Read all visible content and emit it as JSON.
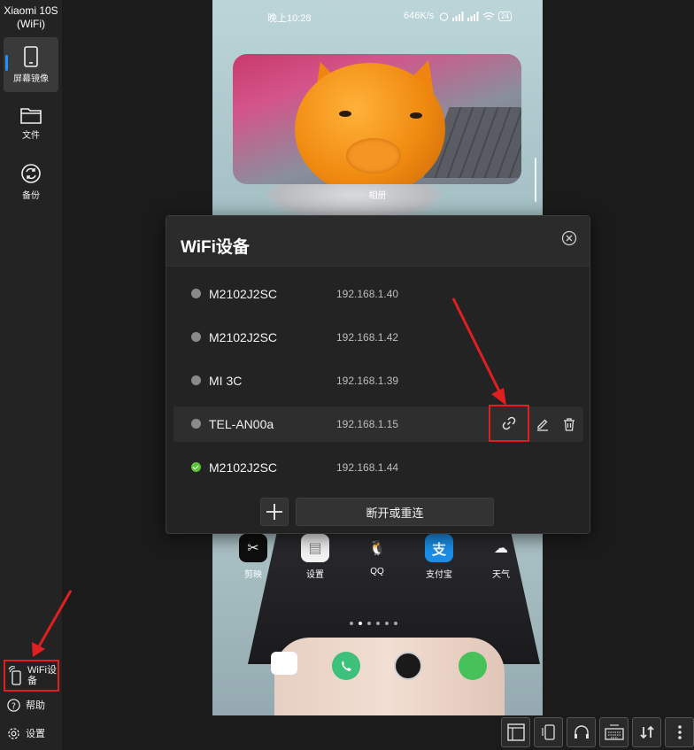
{
  "sidebar": {
    "device_title": "Xiaomi 10S (WiFi)",
    "nav": [
      {
        "label": "屏幕镜像",
        "icon": "phone-icon",
        "active": true
      },
      {
        "label": "文件",
        "icon": "folder-icon",
        "active": false
      },
      {
        "label": "备份",
        "icon": "sync-icon",
        "active": false
      }
    ],
    "wifi_devices_label": "WiFi设备",
    "help_label": "帮助",
    "settings_label": "设置"
  },
  "phone": {
    "status_time": "晚上10:28",
    "status_net": "646K/s",
    "status_battery": "24",
    "widget_label": "相册",
    "apps": [
      {
        "label": "剪映",
        "icon": "jianying-icon",
        "glyph": "✂"
      },
      {
        "label": "设置",
        "icon": "settings-app-icon",
        "glyph": "▤"
      },
      {
        "label": "QQ",
        "icon": "qq-icon",
        "glyph": "🐧"
      },
      {
        "label": "支付宝",
        "icon": "alipay-icon",
        "glyph": "支"
      },
      {
        "label": "天气",
        "icon": "weather-icon",
        "glyph": "☁"
      }
    ]
  },
  "dialog": {
    "title": "WiFi设备",
    "devices": [
      {
        "name": "M2102J2SC",
        "ip": "192.168.1.40",
        "status": "offline"
      },
      {
        "name": "M2102J2SC",
        "ip": "192.168.1.42",
        "status": "offline"
      },
      {
        "name": "MI 3C",
        "ip": "192.168.1.39",
        "status": "offline"
      },
      {
        "name": "TEL-AN00a",
        "ip": "192.168.1.15",
        "status": "offline"
      },
      {
        "name": "M2102J2SC",
        "ip": "192.168.1.44",
        "status": "connected"
      }
    ],
    "reconnect_label": "断开或重连"
  },
  "colors": {
    "accent": "#1e90ff",
    "annotation": "#e02020",
    "connected": "#5bc236",
    "offline": "#8a8a8a"
  }
}
